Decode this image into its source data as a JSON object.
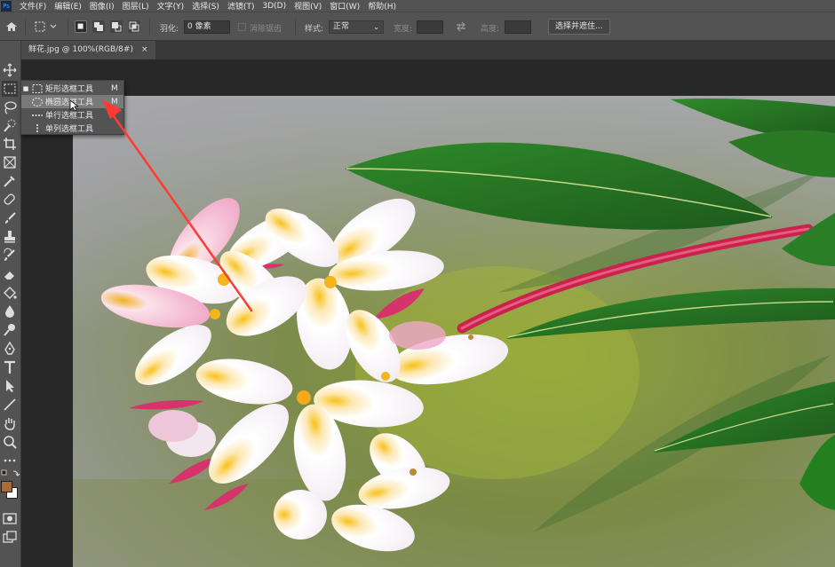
{
  "menubar": {
    "logo": "Ps",
    "items": [
      "文件(F)",
      "编辑(E)",
      "图像(I)",
      "图层(L)",
      "文字(Y)",
      "选择(S)",
      "滤镜(T)",
      "3D(D)",
      "视图(V)",
      "窗口(W)",
      "帮助(H)"
    ]
  },
  "options": {
    "feather_label": "羽化:",
    "feather_value": "0 像素",
    "antialias_label": "消除锯齿",
    "style_label": "样式:",
    "style_value": "正常",
    "width_label": "宽度:",
    "height_label": "高度:",
    "select_mask_label": "选择并遮住..."
  },
  "document": {
    "tab_title": "鲜花.jpg @ 100%(RGB/8#)",
    "close_glyph": "×"
  },
  "flyout": {
    "items": [
      {
        "label": "矩形选框工具",
        "key": "M",
        "icon": "rect-marquee-icon",
        "active": true,
        "selected": false
      },
      {
        "label": "椭圆选框工具",
        "key": "M",
        "icon": "ellipse-marquee-icon",
        "active": false,
        "selected": true
      },
      {
        "label": "单行选框工具",
        "key": "",
        "icon": "single-row-marquee-icon",
        "active": false,
        "selected": false
      },
      {
        "label": "单列选框工具",
        "key": "",
        "icon": "single-column-marquee-icon",
        "active": false,
        "selected": false
      }
    ]
  },
  "tools": [
    "move-icon",
    "marquee-icon",
    "lasso-icon",
    "quick-select-icon",
    "crop-icon",
    "frame-icon",
    "eyedropper-icon",
    "healing-brush-icon",
    "brush-icon",
    "clone-stamp-icon",
    "history-brush-icon",
    "eraser-icon",
    "paint-bucket-icon",
    "blur-icon",
    "dodge-icon",
    "pen-icon",
    "type-icon",
    "path-select-icon",
    "line-icon",
    "hand-icon",
    "zoom-icon",
    "more-tools-icon"
  ],
  "colors": {
    "foreground": "#a86b3a",
    "background": "#ffffff",
    "annotation_arrow": "#ff3b30"
  }
}
